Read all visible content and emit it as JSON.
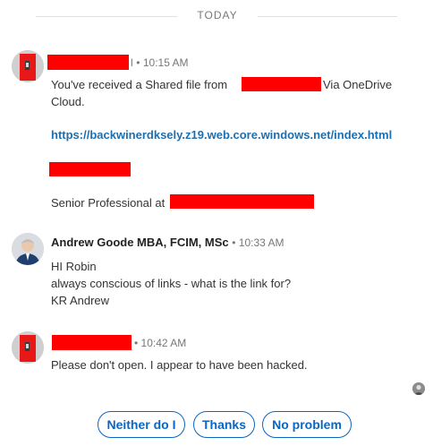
{
  "day_divider": {
    "label": "TODAY"
  },
  "messages": [
    {
      "time": "10:15 AM",
      "lines": [
        {
          "before": "You've received a Shared file from",
          "after": "Via OneDrive"
        },
        {
          "text": "Cloud."
        }
      ],
      "link": "https://backwinerdksely.z19.web.core.windows.net/index.html",
      "signature_prefix": "Senior Professional at"
    },
    {
      "sender": "Andrew Goode MBA, FCIM, MSc",
      "time": "10:33 AM",
      "lines": [
        "HI Robin",
        "always conscious of links - what is the link for?",
        "KR Andrew"
      ]
    },
    {
      "time": "10:42 AM",
      "lines": [
        "Please don't open. I appear to have been hacked."
      ]
    }
  ],
  "quick_replies": [
    "Neither do I",
    "Thanks",
    "No problem"
  ],
  "colors": {
    "redaction": "#ff0000",
    "link": "#1d6fb0",
    "button": "#0a66c2"
  }
}
